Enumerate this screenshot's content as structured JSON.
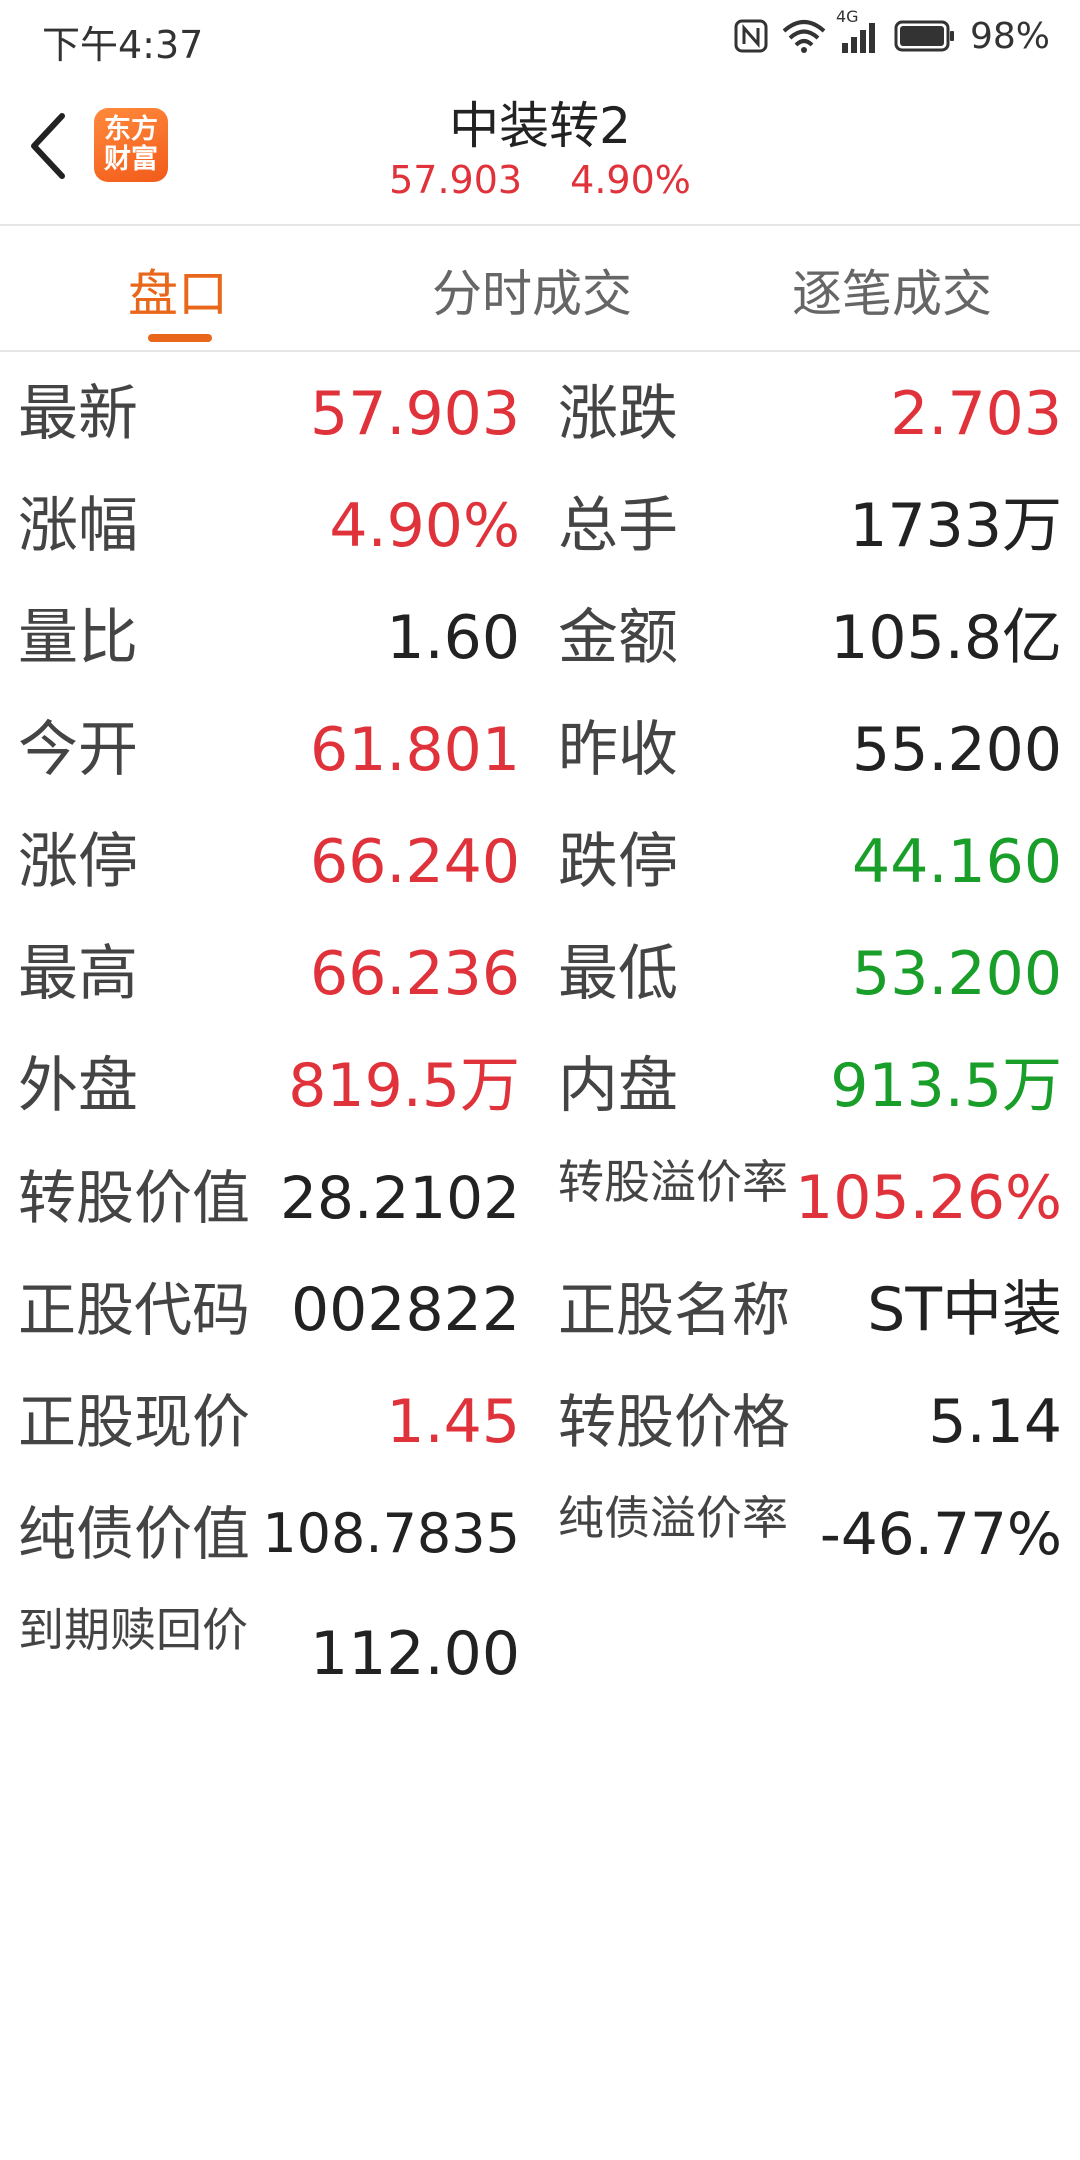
{
  "status": {
    "time": "下午4:37",
    "battery": "98%",
    "network": "4G"
  },
  "header": {
    "title": "中装转2",
    "price": "57.903",
    "change_pct": "4.90%",
    "logo_line1": "东方",
    "logo_line2": "财富"
  },
  "tabs": [
    {
      "label": "盘口",
      "active": true
    },
    {
      "label": "分时成交",
      "active": false
    },
    {
      "label": "逐笔成交",
      "active": false
    }
  ],
  "rows": [
    {
      "l_label": "最新",
      "l_value": "57.903",
      "r_label": "涨跌",
      "r_value": "2.703"
    },
    {
      "l_label": "涨幅",
      "l_value": "4.90%",
      "r_label": "总手",
      "r_value": "1733万"
    },
    {
      "l_label": "量比",
      "l_value": "1.60",
      "r_label": "金额",
      "r_value": "105.8亿"
    },
    {
      "l_label": "今开",
      "l_value": "61.801",
      "r_label": "昨收",
      "r_value": "55.200"
    },
    {
      "l_label": "涨停",
      "l_value": "66.240",
      "r_label": "跌停",
      "r_value": "44.160"
    },
    {
      "l_label": "最高",
      "l_value": "66.236",
      "r_label": "最低",
      "r_value": "53.200"
    },
    {
      "l_label": "外盘",
      "l_value": "819.5万",
      "r_label": "内盘",
      "r_value": "913.5万"
    },
    {
      "l_label": "转股价值",
      "l_value": "28.2102",
      "r_label": "转股溢价率",
      "r_value": "105.26%"
    },
    {
      "l_label": "正股代码",
      "l_value": "002822",
      "r_label": "正股名称",
      "r_value": "ST中装"
    },
    {
      "l_label": "正股现价",
      "l_value": "1.45",
      "r_label": "转股价格",
      "r_value": "5.14"
    },
    {
      "l_label": "纯债价值",
      "l_value": "108.7835",
      "r_label": "纯债溢价率",
      "r_value": "-46.77%"
    },
    {
      "l_label": "到期赎回价",
      "l_value": "112.00",
      "r_label": "",
      "r_value": ""
    }
  ],
  "colors": {
    "up": "#e0323a",
    "down": "#1a9e2a",
    "accent": "#e8671b",
    "text": "#222222"
  }
}
